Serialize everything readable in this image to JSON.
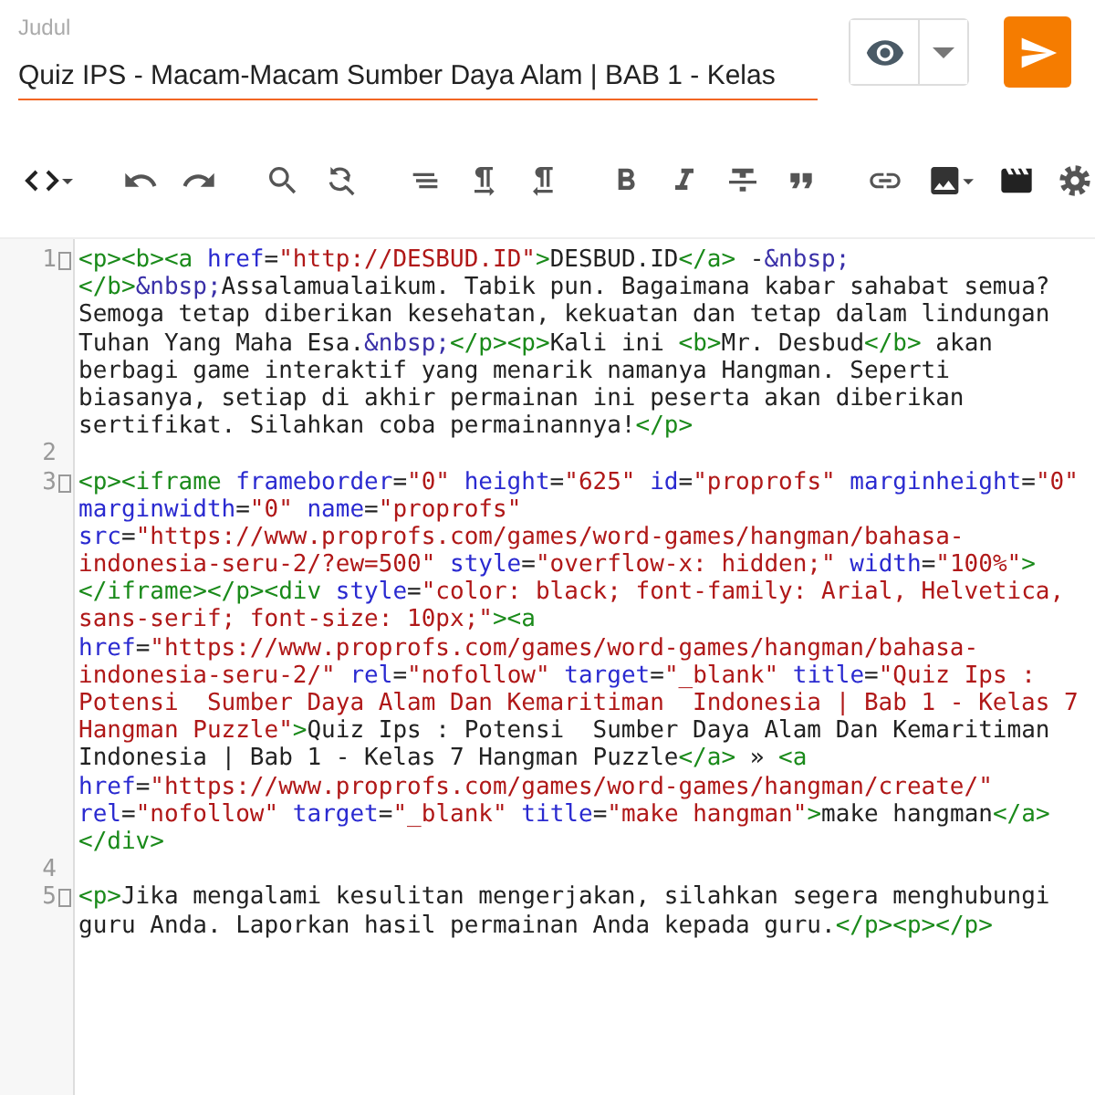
{
  "header": {
    "label": "Judul",
    "title": "Quiz IPS - Macam-Macam Sumber Daya Alam | BAB 1 - Kelas"
  },
  "editor": {
    "lines": [
      {
        "number": "1",
        "foldable": true,
        "rows": [
          {
            "segments": [
              {
                "kind": "tag",
                "text": "<p><b><a "
              },
              {
                "kind": "attr",
                "text": "href"
              },
              {
                "kind": "text",
                "text": "="
              },
              {
                "kind": "value",
                "text": "\"http://DESBUD.ID\""
              },
              {
                "kind": "tag",
                "text": ">"
              },
              {
                "kind": "text",
                "text": "DESBUD.ID"
              },
              {
                "kind": "tag",
                "text": "</a>"
              },
              {
                "kind": "text",
                "text": " -"
              },
              {
                "kind": "entity",
                "text": "&nbsp;"
              }
            ]
          },
          {
            "segments": [
              {
                "kind": "tag",
                "text": "</b>"
              },
              {
                "kind": "entity",
                "text": "&nbsp;"
              },
              {
                "kind": "text",
                "text": "Assalamualaikum. Tabik pun. Bagaimana kabar sahabat semua?"
              }
            ]
          },
          {
            "segments": [
              {
                "kind": "text",
                "text": "Semoga tetap diberikan kesehatan, kekuatan dan tetap dalam lindungan"
              }
            ]
          },
          {
            "segments": [
              {
                "kind": "text",
                "text": "Tuhan Yang Maha Esa."
              },
              {
                "kind": "entity",
                "text": "&nbsp;"
              },
              {
                "kind": "tag",
                "text": "</p><p>"
              },
              {
                "kind": "text",
                "text": "Kali ini "
              },
              {
                "kind": "tag",
                "text": "<b>"
              },
              {
                "kind": "text",
                "text": "Mr. Desbud"
              },
              {
                "kind": "tag",
                "text": "</b>"
              },
              {
                "kind": "text",
                "text": " akan"
              }
            ]
          },
          {
            "segments": [
              {
                "kind": "text",
                "text": "berbagi game interaktif yang menarik namanya Hangman. Seperti"
              }
            ]
          },
          {
            "segments": [
              {
                "kind": "text",
                "text": "biasanya, setiap di akhir permainan ini peserta akan diberikan"
              }
            ]
          },
          {
            "segments": [
              {
                "kind": "text",
                "text": "sertifikat. Silahkan coba permainannya!"
              },
              {
                "kind": "tag",
                "text": "</p>"
              }
            ]
          }
        ]
      },
      {
        "number": "2",
        "foldable": false
      },
      {
        "number": "3",
        "foldable": true,
        "rows": [
          {
            "segments": [
              {
                "kind": "tag",
                "text": "<p><iframe "
              },
              {
                "kind": "attr",
                "text": "frameborder"
              },
              {
                "kind": "text",
                "text": "="
              },
              {
                "kind": "value",
                "text": "\"0\""
              },
              {
                "kind": "attr",
                "text": " height"
              },
              {
                "kind": "text",
                "text": "="
              },
              {
                "kind": "value",
                "text": "\"625\""
              },
              {
                "kind": "attr",
                "text": " id"
              },
              {
                "kind": "text",
                "text": "="
              },
              {
                "kind": "value",
                "text": "\"proprofs\""
              },
              {
                "kind": "attr",
                "text": " marginheight"
              },
              {
                "kind": "text",
                "text": "="
              },
              {
                "kind": "value",
                "text": "\"0\""
              }
            ]
          },
          {
            "segments": [
              {
                "kind": "attr",
                "text": "marginwidth"
              },
              {
                "kind": "text",
                "text": "="
              },
              {
                "kind": "value",
                "text": "\"0\""
              },
              {
                "kind": "attr",
                "text": " name"
              },
              {
                "kind": "text",
                "text": "="
              },
              {
                "kind": "value",
                "text": "\"proprofs\""
              }
            ]
          },
          {
            "segments": [
              {
                "kind": "attr",
                "text": "src"
              },
              {
                "kind": "text",
                "text": "="
              },
              {
                "kind": "value",
                "text": "\"https://www.proprofs.com/games/word-games/hangman/bahasa-"
              }
            ]
          },
          {
            "segments": [
              {
                "kind": "value",
                "text": "indonesia-seru-2/?ew=500\""
              },
              {
                "kind": "attr",
                "text": " style"
              },
              {
                "kind": "text",
                "text": "="
              },
              {
                "kind": "value",
                "text": "\"overflow-x: hidden;\""
              },
              {
                "kind": "attr",
                "text": " width"
              },
              {
                "kind": "text",
                "text": "="
              },
              {
                "kind": "value",
                "text": "\"100%\""
              },
              {
                "kind": "tag",
                "text": ">"
              }
            ]
          },
          {
            "segments": [
              {
                "kind": "tag",
                "text": "</iframe></p><div "
              },
              {
                "kind": "attr",
                "text": "style"
              },
              {
                "kind": "text",
                "text": "="
              },
              {
                "kind": "value",
                "text": "\"color: black; font-family: Arial, Helvetica,"
              }
            ]
          },
          {
            "segments": [
              {
                "kind": "value",
                "text": "sans-serif; font-size: 10px;\""
              },
              {
                "kind": "tag",
                "text": "><a"
              }
            ]
          },
          {
            "segments": [
              {
                "kind": "attr",
                "text": "href"
              },
              {
                "kind": "text",
                "text": "="
              },
              {
                "kind": "value",
                "text": "\"https://www.proprofs.com/games/word-games/hangman/bahasa-"
              }
            ]
          },
          {
            "segments": [
              {
                "kind": "value",
                "text": "indonesia-seru-2/\""
              },
              {
                "kind": "attr",
                "text": " rel"
              },
              {
                "kind": "text",
                "text": "="
              },
              {
                "kind": "value",
                "text": "\"nofollow\""
              },
              {
                "kind": "attr",
                "text": " target"
              },
              {
                "kind": "text",
                "text": "="
              },
              {
                "kind": "value",
                "text": "\"_blank\""
              },
              {
                "kind": "attr",
                "text": " title"
              },
              {
                "kind": "text",
                "text": "="
              },
              {
                "kind": "value",
                "text": "\"Quiz Ips :"
              }
            ]
          },
          {
            "segments": [
              {
                "kind": "value",
                "text": "Potensi  Sumber Daya Alam Dan Kemaritiman  Indonesia | Bab 1 - Kelas 7"
              }
            ]
          },
          {
            "segments": [
              {
                "kind": "value",
                "text": "Hangman Puzzle\""
              },
              {
                "kind": "tag",
                "text": ">"
              },
              {
                "kind": "text",
                "text": "Quiz Ips : Potensi  Sumber Daya Alam Dan Kemaritiman"
              }
            ]
          },
          {
            "segments": [
              {
                "kind": "text",
                "text": "Indonesia | Bab 1 - Kelas 7 Hangman Puzzle"
              },
              {
                "kind": "tag",
                "text": "</a>"
              },
              {
                "kind": "text",
                "text": " » "
              },
              {
                "kind": "tag",
                "text": "<a"
              }
            ]
          },
          {
            "segments": [
              {
                "kind": "attr",
                "text": "href"
              },
              {
                "kind": "text",
                "text": "="
              },
              {
                "kind": "value",
                "text": "\"https://www.proprofs.com/games/word-games/hangman/create/\""
              }
            ]
          },
          {
            "segments": [
              {
                "kind": "attr",
                "text": "rel"
              },
              {
                "kind": "text",
                "text": "="
              },
              {
                "kind": "value",
                "text": "\"nofollow\""
              },
              {
                "kind": "attr",
                "text": " target"
              },
              {
                "kind": "text",
                "text": "="
              },
              {
                "kind": "value",
                "text": "\"_blank\""
              },
              {
                "kind": "attr",
                "text": " title"
              },
              {
                "kind": "text",
                "text": "="
              },
              {
                "kind": "value",
                "text": "\"make hangman\""
              },
              {
                "kind": "tag",
                "text": ">"
              },
              {
                "kind": "text",
                "text": "make hangman"
              },
              {
                "kind": "tag",
                "text": "</a>"
              }
            ]
          },
          {
            "segments": [
              {
                "kind": "tag",
                "text": "</div>"
              }
            ]
          }
        ]
      },
      {
        "number": "4",
        "foldable": false
      },
      {
        "number": "5",
        "foldable": true,
        "rows": [
          {
            "segments": [
              {
                "kind": "tag",
                "text": "<p>"
              },
              {
                "kind": "text",
                "text": "Jika mengalami kesulitan mengerjakan, silahkan segera menghubungi"
              }
            ]
          },
          {
            "segments": [
              {
                "kind": "text",
                "text": "guru Anda. Laporkan hasil permainan Anda kepada guru."
              },
              {
                "kind": "tag",
                "text": "</p><p></p>"
              }
            ]
          }
        ]
      }
    ]
  }
}
